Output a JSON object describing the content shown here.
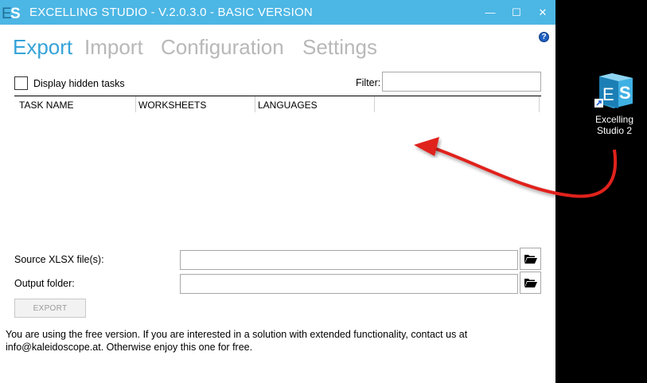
{
  "window": {
    "title": "EXCELLING STUDIO - V.2.0.3.0 - BASIC VERSION",
    "logo_text": "ES",
    "minimize_glyph": "—",
    "maximize_glyph": "☐",
    "close_glyph": "✕"
  },
  "tabs": [
    {
      "label": "Export",
      "active": true
    },
    {
      "label": "Import",
      "active": false
    },
    {
      "label": "Configuration",
      "active": false
    },
    {
      "label": "Settings",
      "active": false
    }
  ],
  "help_glyph": "?",
  "display_hidden_label": "Display hidden tasks",
  "filter": {
    "label": "Filter:",
    "value": ""
  },
  "grid_columns": [
    "TASK NAME",
    "WORKSHEETS",
    "LANGUAGES",
    ""
  ],
  "source": {
    "label": "Source XLSX file(s):",
    "value": ""
  },
  "output": {
    "label": "Output folder:",
    "value": ""
  },
  "export_button": "EXPORT",
  "info_text": "You are using the free version. If you are interested in a solution with extended functionality, contact us at info@kaleidoscope.at. Otherwise enjoy this one for free.",
  "desktop_icon": {
    "label_line1": "Excelling",
    "label_line2": "Studio 2"
  },
  "colors": {
    "accent": "#35a3d8",
    "titlebar": "#4cb6e4",
    "arrow": "#e0201b",
    "inactive_tab": "#b8b8b8"
  },
  "icons": [
    "folder-open-icon",
    "help-icon",
    "shortcut-arrow-icon"
  ]
}
